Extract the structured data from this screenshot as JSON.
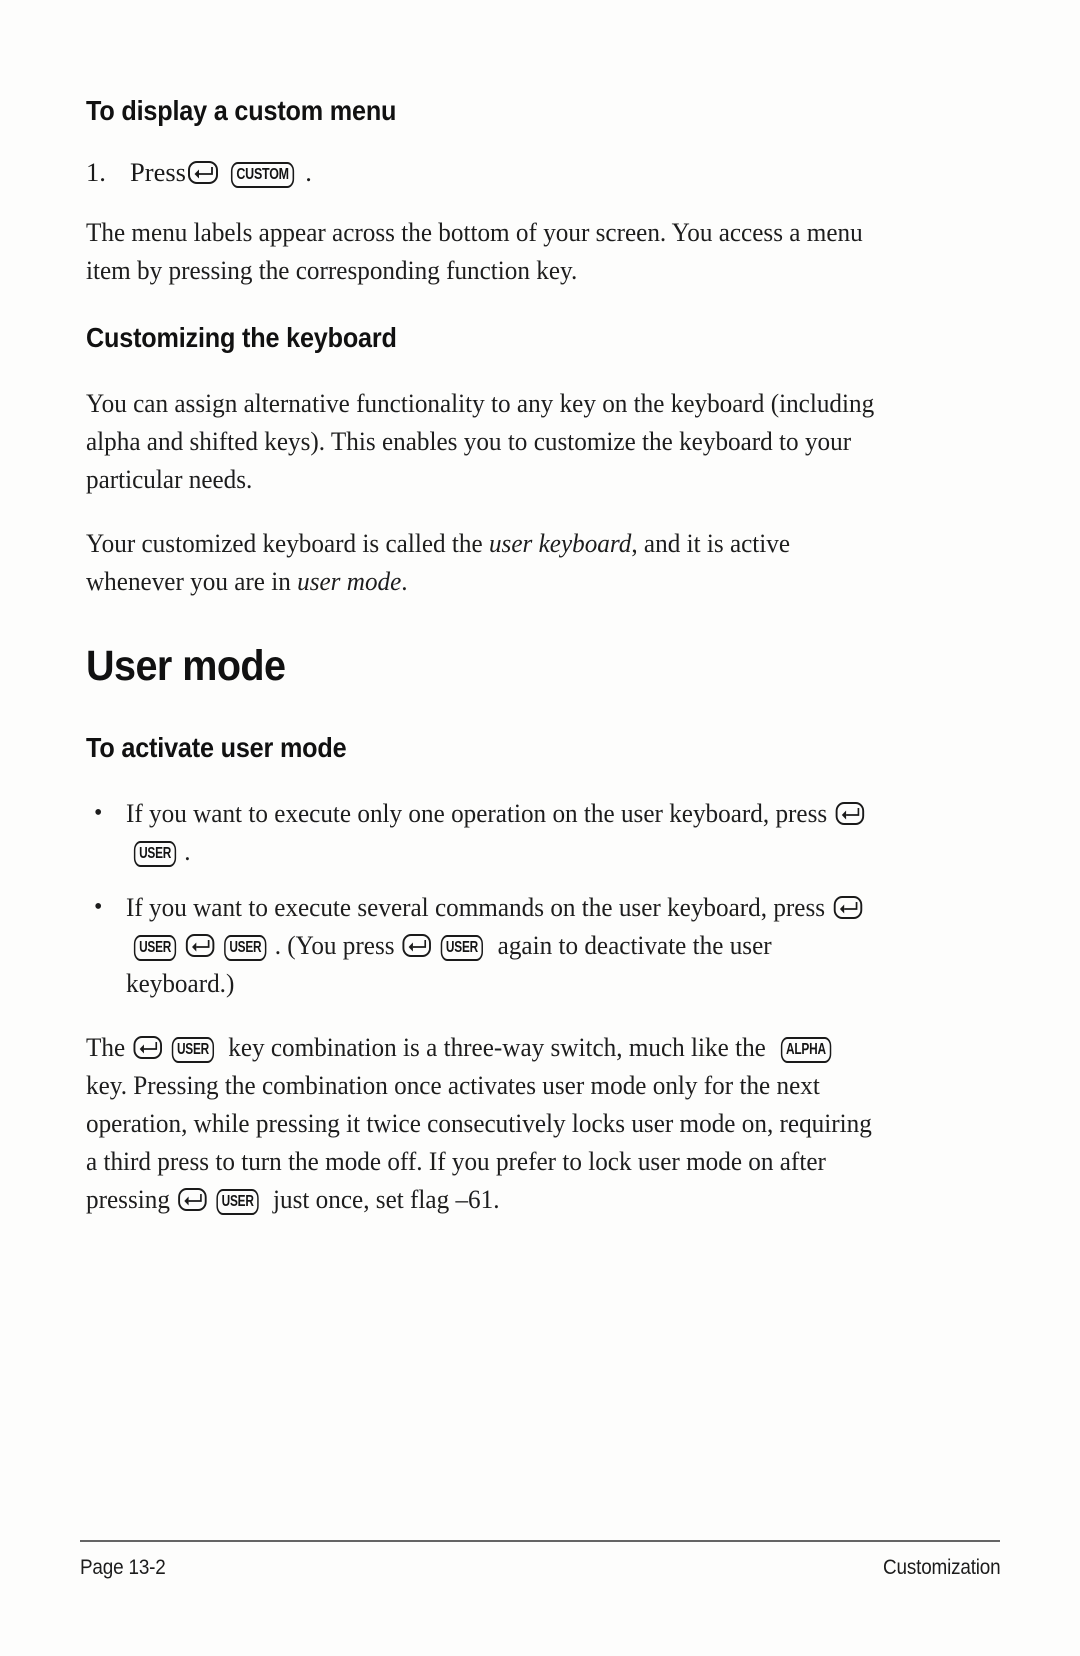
{
  "document": {
    "type": "scanned-manual-page",
    "sections": {
      "custom_menu": {
        "heading": "To display a custom menu",
        "step_number": "1.",
        "step_prefix": "Press",
        "step_suffix": ".",
        "paragraph": "The menu labels appear across the bottom of your screen. You access a menu item by pressing the corresponding function key."
      },
      "customizing_keyboard": {
        "heading": "Customizing the keyboard",
        "paragraph_1": "You can assign alternative functionality to any key on the keyboard (including alpha and shifted keys). This enables you to customize the keyboard to your particular needs.",
        "paragraph_2_a": "Your customized keyboard is called the ",
        "paragraph_2_italic_1": "user keyboard",
        "paragraph_2_b": ", and it is active whenever you are in ",
        "paragraph_2_italic_2": "user mode",
        "paragraph_2_c": "."
      },
      "user_mode": {
        "chapter_heading": "User mode",
        "sub_heading": "To activate user mode",
        "bullets": [
          {
            "marker": "•",
            "text_a": "If you want to execute only one operation on the user keyboard, press ",
            "text_b": "."
          },
          {
            "marker": "•",
            "text_a": "If you want to execute several commands on the user keyboard, press ",
            "text_b": ". (You press ",
            "text_c": " again to deactivate the user keyboard.)"
          }
        ],
        "closing_paragraph": {
          "a": "The ",
          "b": " key combination is a three-way switch, much like the ",
          "c": " key. Pressing the combination once activates user mode only for the next operation, while pressing it twice consecutively locks user mode on, requiring a third press to turn the mode off. If you prefer to lock user mode on after pressing ",
          "d": " just once, set flag –61."
        }
      }
    },
    "keys": {
      "shift_left_arrow": "left-arrow-shift",
      "custom": "CUSTOM",
      "user": "USER",
      "alpha": "ALPHA"
    },
    "footer": {
      "page_label": "Page 13-2",
      "chapter_label": "Customization"
    },
    "colors": {
      "text": "#1a1a1a",
      "page_background": "#fdfdfc",
      "rule": "#4a4a4a"
    }
  }
}
